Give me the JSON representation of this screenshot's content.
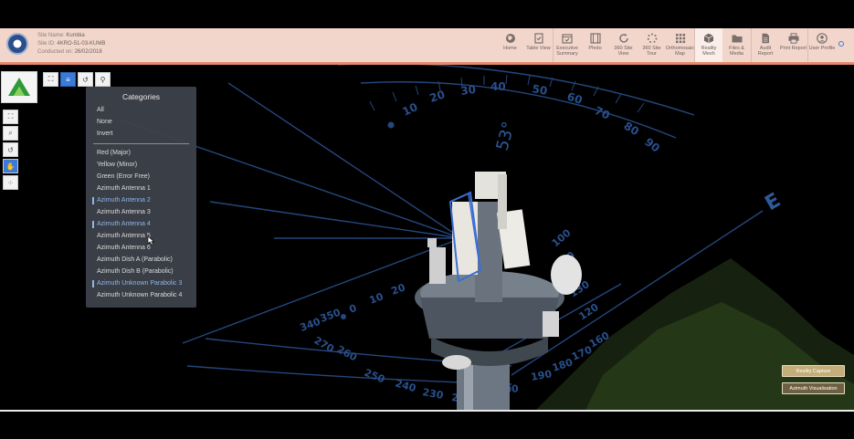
{
  "site_info": {
    "site_name_label": "Site Name:",
    "site_name_value": "Kumbia",
    "site_id_label": "Site ID:",
    "site_id_value": "4KRO-51-03-KUMB",
    "conducted_label": "Conducted on:",
    "conducted_value": "26/02/2018"
  },
  "nav": [
    {
      "label": "Home",
      "icon": "globe-icon"
    },
    {
      "label": "Table View",
      "icon": "clipboard-check-icon"
    },
    {
      "label": "Executive Summary",
      "icon": "calendar-check-icon"
    },
    {
      "label": "Photo",
      "icon": "film-icon"
    },
    {
      "label": "360 Site View",
      "icon": "rotate-icon"
    },
    {
      "label": "360 Site Tour",
      "icon": "spinner-icon"
    },
    {
      "label": "Orthomosaic Map",
      "icon": "grid-icon"
    },
    {
      "label": "Reality Mesh",
      "icon": "cube-icon"
    },
    {
      "label": "Files & Media",
      "icon": "folder-icon"
    },
    {
      "label": "Audit Report",
      "icon": "document-icon"
    },
    {
      "label": "Print Report",
      "icon": "print-icon"
    },
    {
      "label": "User Profile",
      "icon": "user-icon"
    }
  ],
  "colors": {
    "header_bg": "#f2d6cc",
    "header_accent": "#e58a6a",
    "accent_blue": "#3b7bd8",
    "selected_item": "#8fb6ea",
    "overlay_lines": "#2c4f8c",
    "pill_gold": "#c4ad78"
  },
  "categories": {
    "title": "Categories",
    "general": [
      "All",
      "None",
      "Invert"
    ],
    "items": [
      {
        "label": "Red (Major)",
        "selected": false
      },
      {
        "label": "Yellow (Minor)",
        "selected": false
      },
      {
        "label": "Green (Error Free)",
        "selected": false
      },
      {
        "label": "Azimuth Antenna 1",
        "selected": false
      },
      {
        "label": "Azimuth Antenna 2",
        "selected": true
      },
      {
        "label": "Azimuth Antenna 3",
        "selected": false
      },
      {
        "label": "Azimuth Antenna 4",
        "selected": true
      },
      {
        "label": "Azimuth Antenna 5",
        "selected": false
      },
      {
        "label": "Azimuth Antenna 6",
        "selected": false
      },
      {
        "label": "Azimuth Dish A (Parabolic)",
        "selected": false
      },
      {
        "label": "Azimuth Dish B (Parabolic)",
        "selected": false
      },
      {
        "label": "Azimuth Unknown Parabolic 3",
        "selected": true
      },
      {
        "label": "Azimuth Unknown Parabolic 4",
        "selected": false
      }
    ]
  },
  "scene": {
    "azimuth_readout": "53°",
    "compass_letter": "E",
    "ticks_upper": [
      "10",
      "20",
      "30",
      "40",
      "50",
      "60",
      "70",
      "80",
      "90"
    ],
    "ticks_lower": [
      "20",
      "10",
      "0",
      "350",
      "340",
      "270",
      "260",
      "250",
      "240",
      "230",
      "220",
      "210",
      "200",
      "190",
      "180",
      "170",
      "160",
      "130",
      "120",
      "110",
      "100",
      "90"
    ]
  },
  "buttons": {
    "reality_capture": "Reality Capture",
    "azimuth_visualisation": "Azimuth Visualisation"
  }
}
